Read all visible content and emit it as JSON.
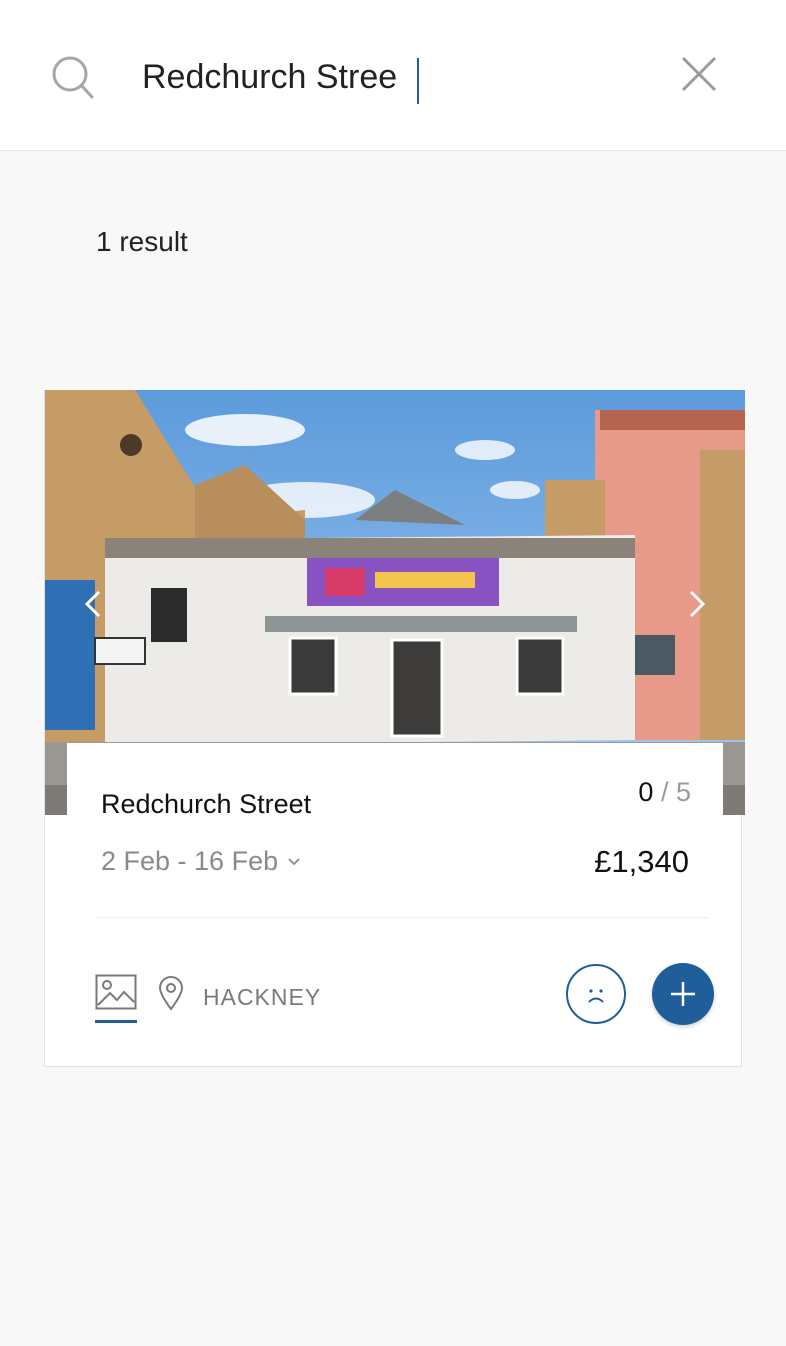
{
  "search": {
    "value": "Redchurch Stree",
    "placeholder": ""
  },
  "results": {
    "count_label": "1 result"
  },
  "listing": {
    "title": "Redchurch Street",
    "capacity_current": "0",
    "capacity_separator": "/",
    "capacity_max": "5",
    "date_range": "2 Feb - 16 Feb",
    "price": "£1,340",
    "district": "HACKNEY"
  },
  "colors": {
    "accent": "#1f5e9b",
    "muted_text": "#8a8a8a",
    "background": "#f8f8f8"
  },
  "icons": {
    "search": "search-icon",
    "close": "close-icon",
    "gallery": "image-gallery-icon",
    "location": "map-pin-icon",
    "dislike": "sad-face-icon",
    "add": "plus-icon",
    "prev": "chevron-left-icon",
    "next": "chevron-right-icon"
  }
}
